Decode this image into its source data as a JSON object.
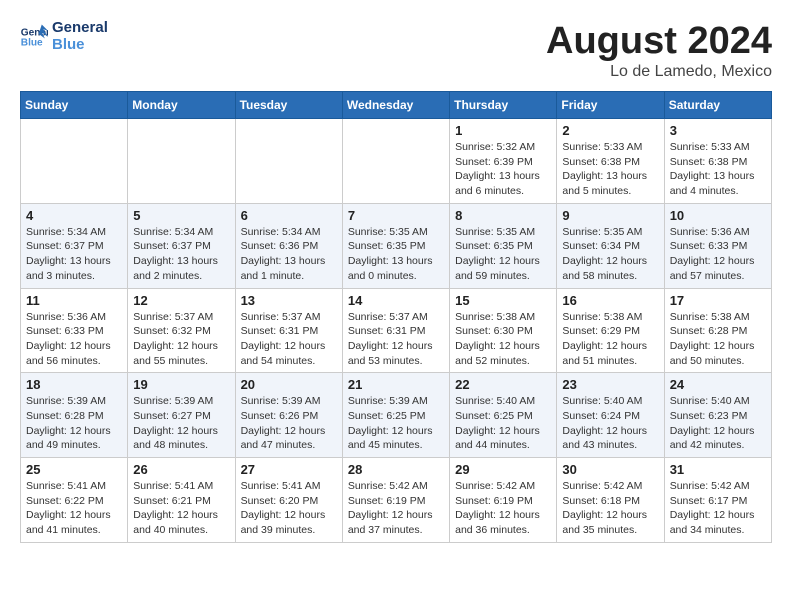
{
  "header": {
    "logo_line1": "General",
    "logo_line2": "Blue",
    "title": "August 2024",
    "subtitle": "Lo de Lamedo, Mexico"
  },
  "days_of_week": [
    "Sunday",
    "Monday",
    "Tuesday",
    "Wednesday",
    "Thursday",
    "Friday",
    "Saturday"
  ],
  "weeks": [
    [
      {
        "day": "",
        "info": ""
      },
      {
        "day": "",
        "info": ""
      },
      {
        "day": "",
        "info": ""
      },
      {
        "day": "",
        "info": ""
      },
      {
        "day": "1",
        "info": "Sunrise: 5:32 AM\nSunset: 6:39 PM\nDaylight: 13 hours\nand 6 minutes."
      },
      {
        "day": "2",
        "info": "Sunrise: 5:33 AM\nSunset: 6:38 PM\nDaylight: 13 hours\nand 5 minutes."
      },
      {
        "day": "3",
        "info": "Sunrise: 5:33 AM\nSunset: 6:38 PM\nDaylight: 13 hours\nand 4 minutes."
      }
    ],
    [
      {
        "day": "4",
        "info": "Sunrise: 5:34 AM\nSunset: 6:37 PM\nDaylight: 13 hours\nand 3 minutes."
      },
      {
        "day": "5",
        "info": "Sunrise: 5:34 AM\nSunset: 6:37 PM\nDaylight: 13 hours\nand 2 minutes."
      },
      {
        "day": "6",
        "info": "Sunrise: 5:34 AM\nSunset: 6:36 PM\nDaylight: 13 hours\nand 1 minute."
      },
      {
        "day": "7",
        "info": "Sunrise: 5:35 AM\nSunset: 6:35 PM\nDaylight: 13 hours\nand 0 minutes."
      },
      {
        "day": "8",
        "info": "Sunrise: 5:35 AM\nSunset: 6:35 PM\nDaylight: 12 hours\nand 59 minutes."
      },
      {
        "day": "9",
        "info": "Sunrise: 5:35 AM\nSunset: 6:34 PM\nDaylight: 12 hours\nand 58 minutes."
      },
      {
        "day": "10",
        "info": "Sunrise: 5:36 AM\nSunset: 6:33 PM\nDaylight: 12 hours\nand 57 minutes."
      }
    ],
    [
      {
        "day": "11",
        "info": "Sunrise: 5:36 AM\nSunset: 6:33 PM\nDaylight: 12 hours\nand 56 minutes."
      },
      {
        "day": "12",
        "info": "Sunrise: 5:37 AM\nSunset: 6:32 PM\nDaylight: 12 hours\nand 55 minutes."
      },
      {
        "day": "13",
        "info": "Sunrise: 5:37 AM\nSunset: 6:31 PM\nDaylight: 12 hours\nand 54 minutes."
      },
      {
        "day": "14",
        "info": "Sunrise: 5:37 AM\nSunset: 6:31 PM\nDaylight: 12 hours\nand 53 minutes."
      },
      {
        "day": "15",
        "info": "Sunrise: 5:38 AM\nSunset: 6:30 PM\nDaylight: 12 hours\nand 52 minutes."
      },
      {
        "day": "16",
        "info": "Sunrise: 5:38 AM\nSunset: 6:29 PM\nDaylight: 12 hours\nand 51 minutes."
      },
      {
        "day": "17",
        "info": "Sunrise: 5:38 AM\nSunset: 6:28 PM\nDaylight: 12 hours\nand 50 minutes."
      }
    ],
    [
      {
        "day": "18",
        "info": "Sunrise: 5:39 AM\nSunset: 6:28 PM\nDaylight: 12 hours\nand 49 minutes."
      },
      {
        "day": "19",
        "info": "Sunrise: 5:39 AM\nSunset: 6:27 PM\nDaylight: 12 hours\nand 48 minutes."
      },
      {
        "day": "20",
        "info": "Sunrise: 5:39 AM\nSunset: 6:26 PM\nDaylight: 12 hours\nand 47 minutes."
      },
      {
        "day": "21",
        "info": "Sunrise: 5:39 AM\nSunset: 6:25 PM\nDaylight: 12 hours\nand 45 minutes."
      },
      {
        "day": "22",
        "info": "Sunrise: 5:40 AM\nSunset: 6:25 PM\nDaylight: 12 hours\nand 44 minutes."
      },
      {
        "day": "23",
        "info": "Sunrise: 5:40 AM\nSunset: 6:24 PM\nDaylight: 12 hours\nand 43 minutes."
      },
      {
        "day": "24",
        "info": "Sunrise: 5:40 AM\nSunset: 6:23 PM\nDaylight: 12 hours\nand 42 minutes."
      }
    ],
    [
      {
        "day": "25",
        "info": "Sunrise: 5:41 AM\nSunset: 6:22 PM\nDaylight: 12 hours\nand 41 minutes."
      },
      {
        "day": "26",
        "info": "Sunrise: 5:41 AM\nSunset: 6:21 PM\nDaylight: 12 hours\nand 40 minutes."
      },
      {
        "day": "27",
        "info": "Sunrise: 5:41 AM\nSunset: 6:20 PM\nDaylight: 12 hours\nand 39 minutes."
      },
      {
        "day": "28",
        "info": "Sunrise: 5:42 AM\nSunset: 6:19 PM\nDaylight: 12 hours\nand 37 minutes."
      },
      {
        "day": "29",
        "info": "Sunrise: 5:42 AM\nSunset: 6:19 PM\nDaylight: 12 hours\nand 36 minutes."
      },
      {
        "day": "30",
        "info": "Sunrise: 5:42 AM\nSunset: 6:18 PM\nDaylight: 12 hours\nand 35 minutes."
      },
      {
        "day": "31",
        "info": "Sunrise: 5:42 AM\nSunset: 6:17 PM\nDaylight: 12 hours\nand 34 minutes."
      }
    ]
  ]
}
